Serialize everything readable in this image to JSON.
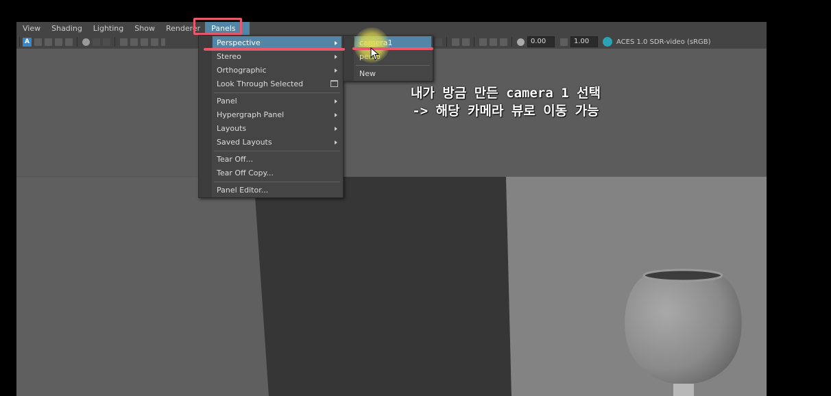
{
  "menubar": {
    "items": [
      "View",
      "Shading",
      "Lighting",
      "Show",
      "Renderer",
      "Panels"
    ],
    "active": "Panels"
  },
  "toolbar": {
    "exposure_value": "0.00",
    "gamma_value": "1.00",
    "color_space": "ACES 1.0 SDR-video (sRGB)"
  },
  "panels_menu": {
    "groups": [
      [
        {
          "label": "Perspective",
          "submenu": true,
          "active": true
        },
        {
          "label": "Stereo",
          "submenu": true
        },
        {
          "label": "Orthographic",
          "submenu": true
        },
        {
          "label": "Look Through Selected",
          "icon": "window-icon"
        }
      ],
      [
        {
          "label": "Panel",
          "submenu": true
        },
        {
          "label": "Hypergraph Panel",
          "submenu": true
        },
        {
          "label": "Layouts",
          "submenu": true
        },
        {
          "label": "Saved Layouts",
          "submenu": true
        }
      ],
      [
        {
          "label": "Tear Off..."
        },
        {
          "label": "Tear Off Copy..."
        }
      ],
      [
        {
          "label": "Panel Editor..."
        }
      ]
    ]
  },
  "perspective_submenu": {
    "items": [
      {
        "label": "camera1",
        "active": true
      },
      {
        "label": "persp"
      },
      {
        "label": "New"
      }
    ]
  },
  "annotation": {
    "line1": "내가 방금 만든 camera 1 선택",
    "line2": "-> 해당 카메라 뷰로 이동 가능"
  },
  "colors": {
    "highlight": "#5285a6",
    "annotation_red": "#e85a6b",
    "cursor_glow": "#e2de50",
    "background": "#444444"
  }
}
